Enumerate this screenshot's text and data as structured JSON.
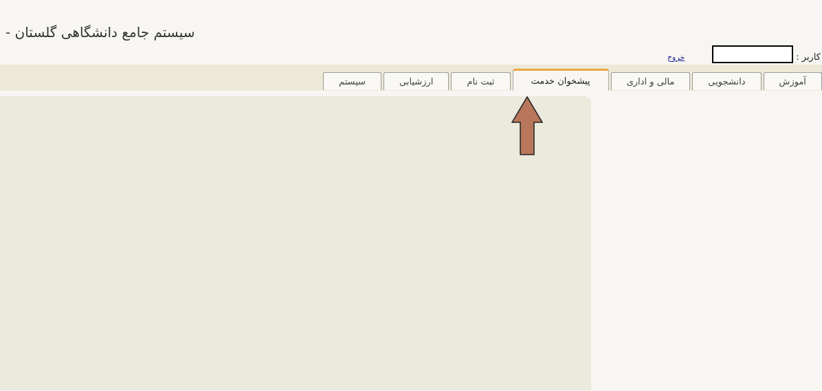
{
  "header": {
    "title": "سیستم جامع دانشگاهی گلستان -",
    "user_label": "کاربر :",
    "logout_link": "خروج"
  },
  "tabs": [
    {
      "label": "آموزش",
      "selected": false
    },
    {
      "label": "دانشجویی",
      "selected": false
    },
    {
      "label": "مالی و اداری",
      "selected": false
    },
    {
      "label": "پیشخوان خدمت",
      "selected": true
    },
    {
      "label": "ثبت نام",
      "selected": false
    },
    {
      "label": "ارزشیابی",
      "selected": false
    },
    {
      "label": "سیستم",
      "selected": false
    }
  ]
}
